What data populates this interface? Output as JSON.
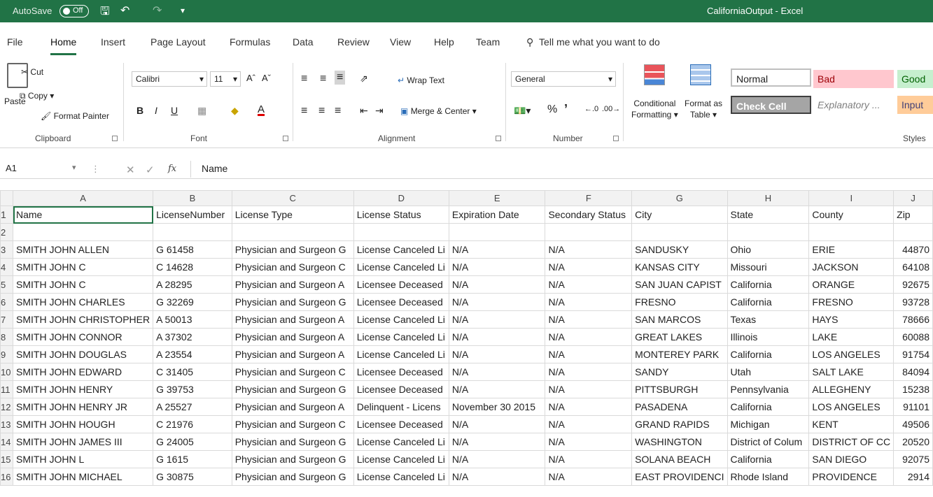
{
  "titlebar": {
    "autosave_label": "AutoSave",
    "autosave_state": "Off",
    "title": "CaliforniaOutput  -  Excel"
  },
  "tabs": [
    "File",
    "Home",
    "Insert",
    "Page Layout",
    "Formulas",
    "Data",
    "Review",
    "View",
    "Help",
    "Team"
  ],
  "tell_me": "Tell me what you want to do",
  "ribbon": {
    "clipboard": {
      "paste": "Paste",
      "cut": "Cut",
      "copy": "Copy",
      "format_painter": "Format Painter",
      "label": "Clipboard"
    },
    "font": {
      "name": "Calibri",
      "size": "11",
      "label": "Font"
    },
    "alignment": {
      "wrap": "Wrap Text",
      "merge": "Merge & Center",
      "label": "Alignment"
    },
    "number": {
      "format": "General",
      "label": "Number"
    },
    "styles": {
      "conditional": [
        "Conditional",
        "Formatting"
      ],
      "format_as": [
        "Format as",
        "Table"
      ],
      "normal": "Normal",
      "bad": "Bad",
      "good": "Good",
      "check": "Check Cell",
      "explanatory": "Explanatory ...",
      "input": "Input",
      "label": "Styles"
    }
  },
  "formula_bar": {
    "cell": "A1",
    "content": "Name"
  },
  "columns": [
    "A",
    "B",
    "C",
    "D",
    "E",
    "F",
    "G",
    "H",
    "I",
    "J"
  ],
  "row_numbers": [
    "1",
    "2",
    "3",
    "4",
    "5",
    "6",
    "7",
    "8",
    "9",
    "10",
    "11",
    "12",
    "13",
    "14",
    "15",
    "16"
  ],
  "header_row": [
    "Name",
    "LicenseNumber",
    "License Type",
    "License Status",
    "Expiration Date",
    "Secondary Status",
    "City",
    "State",
    "County",
    "Zip"
  ],
  "rows": [
    [
      "SMITH  JOHN ALLEN",
      "G 61458",
      "Physician and Surgeon G",
      "License Canceled Li",
      "N/A",
      "N/A",
      "SANDUSKY",
      "Ohio",
      "ERIE",
      "44870"
    ],
    [
      "SMITH  JOHN C",
      "C 14628",
      "Physician and Surgeon C",
      "License Canceled Li",
      "N/A",
      "N/A",
      "KANSAS CITY",
      "Missouri",
      "JACKSON",
      "64108"
    ],
    [
      "SMITH  JOHN C",
      "A 28295",
      "Physician and Surgeon A",
      "Licensee Deceased",
      "N/A",
      "N/A",
      "SAN JUAN CAPIST",
      "California",
      "ORANGE",
      "92675"
    ],
    [
      "SMITH  JOHN CHARLES",
      "G 32269",
      "Physician and Surgeon G",
      "Licensee Deceased",
      "N/A",
      "N/A",
      "FRESNO",
      "California",
      "FRESNO",
      "93728"
    ],
    [
      "SMITH  JOHN CHRISTOPHER",
      "A 50013",
      "Physician and Surgeon A",
      "License Canceled Li",
      "N/A",
      "N/A",
      "SAN MARCOS",
      "Texas",
      "HAYS",
      "78666"
    ],
    [
      "SMITH  JOHN CONNOR",
      "A 37302",
      "Physician and Surgeon A",
      "License Canceled Li",
      "N/A",
      "N/A",
      "GREAT LAKES",
      "Illinois",
      "LAKE",
      "60088"
    ],
    [
      "SMITH  JOHN DOUGLAS",
      "A 23554",
      "Physician and Surgeon A",
      "License Canceled Li",
      "N/A",
      "N/A",
      "MONTEREY PARK",
      "California",
      "LOS ANGELES",
      "91754"
    ],
    [
      "SMITH  JOHN EDWARD",
      "C 31405",
      "Physician and Surgeon C",
      "Licensee Deceased",
      "N/A",
      "N/A",
      "SANDY",
      "Utah",
      "SALT LAKE",
      "84094"
    ],
    [
      "SMITH  JOHN HENRY",
      "G 39753",
      "Physician and Surgeon G",
      "Licensee Deceased",
      "N/A",
      "N/A",
      "PITTSBURGH",
      "Pennsylvania",
      "ALLEGHENY",
      "15238"
    ],
    [
      "SMITH  JOHN HENRY JR",
      "A 25527",
      "Physician and Surgeon A",
      "Delinquent - Licens",
      "November 30  2015",
      "N/A",
      "PASADENA",
      "California",
      "LOS ANGELES",
      "91101"
    ],
    [
      "SMITH  JOHN HOUGH",
      "C 21976",
      "Physician and Surgeon C",
      "Licensee Deceased",
      "N/A",
      "N/A",
      "GRAND RAPIDS",
      "Michigan",
      "KENT",
      "49506"
    ],
    [
      "SMITH  JOHN JAMES III",
      "G 24005",
      "Physician and Surgeon G",
      "License Canceled Li",
      "N/A",
      "N/A",
      "WASHINGTON",
      "District of Colum",
      "DISTRICT OF CC",
      "20520"
    ],
    [
      "SMITH  JOHN L",
      "G 1615",
      "Physician and Surgeon G",
      "License Canceled Li",
      "N/A",
      "N/A",
      "SOLANA BEACH",
      "California",
      "SAN DIEGO",
      "92075"
    ],
    [
      "SMITH  JOHN MICHAEL",
      "G 30875",
      "Physician and Surgeon G",
      "License Canceled Li",
      "N/A",
      "N/A",
      "EAST PROVIDENCI",
      "Rhode Island",
      "PROVIDENCE",
      "2914"
    ]
  ]
}
